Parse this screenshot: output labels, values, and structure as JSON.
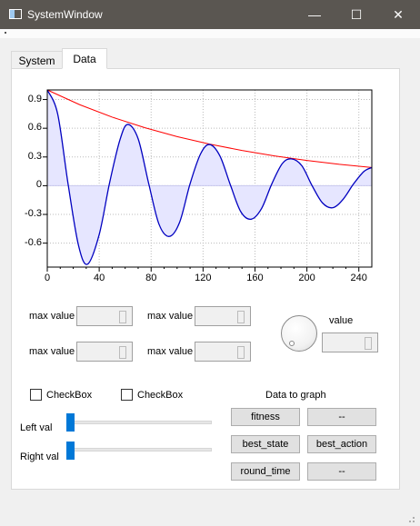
{
  "window": {
    "title": "SystemWindow"
  },
  "window_controls": {
    "minimize": "—",
    "maximize": "☐",
    "close": "✕"
  },
  "tabs": [
    {
      "label": "System",
      "active": false
    },
    {
      "label": "Data",
      "active": true
    }
  ],
  "chart_data": {
    "type": "line",
    "xlim": [
      0,
      250
    ],
    "ylim": [
      -0.85,
      1.0
    ],
    "x_ticks": [
      0,
      40,
      80,
      120,
      160,
      200,
      240
    ],
    "y_ticks": [
      0.9,
      0.6,
      0.3,
      0,
      -0.3,
      -0.6
    ],
    "x_tick_labels": [
      "0",
      "40",
      "80",
      "120",
      "160",
      "200",
      "240"
    ],
    "y_tick_labels": [
      "0.9",
      "0.6",
      "0.3",
      "0",
      "-0.3",
      "-0.6"
    ],
    "grid": true,
    "series": [
      {
        "color": "#ff0000",
        "x": [
          0,
          25,
          50,
          75,
          100,
          125,
          150,
          175,
          200,
          225,
          250
        ],
        "y": [
          1.0,
          0.846,
          0.716,
          0.606,
          0.513,
          0.434,
          0.368,
          0.311,
          0.264,
          0.223,
          0.19
        ]
      },
      {
        "color": "#0000c0",
        "fill": "#e6e6ff",
        "x": [
          0,
          8,
          16,
          24,
          31,
          40,
          48,
          56,
          62,
          70,
          78,
          86,
          94,
          102,
          110,
          118,
          125,
          133,
          141,
          149,
          157,
          165,
          173,
          181,
          188,
          196,
          204,
          212,
          220,
          228,
          236,
          244,
          250
        ],
        "y": [
          1.0,
          0.75,
          0.02,
          -0.62,
          -0.82,
          -0.51,
          0.03,
          0.48,
          0.64,
          0.49,
          0.03,
          -0.4,
          -0.53,
          -0.38,
          0.02,
          0.33,
          0.43,
          0.31,
          0.01,
          -0.27,
          -0.35,
          -0.24,
          0.02,
          0.23,
          0.28,
          0.21,
          0.0,
          -0.18,
          -0.23,
          -0.14,
          0.02,
          0.15,
          0.19
        ]
      }
    ]
  },
  "controls": {
    "max_value_label": "max value",
    "value_label": "value",
    "checkbox_label": "CheckBox",
    "data_to_graph_label": "Data to graph",
    "left_val_label": "Left val",
    "right_val_label": "Right val"
  },
  "graph_buttons": {
    "fitness": "fitness",
    "placeholder": "--",
    "best_state": "best_state",
    "best_action": "best_action",
    "round_time": "round_time"
  }
}
